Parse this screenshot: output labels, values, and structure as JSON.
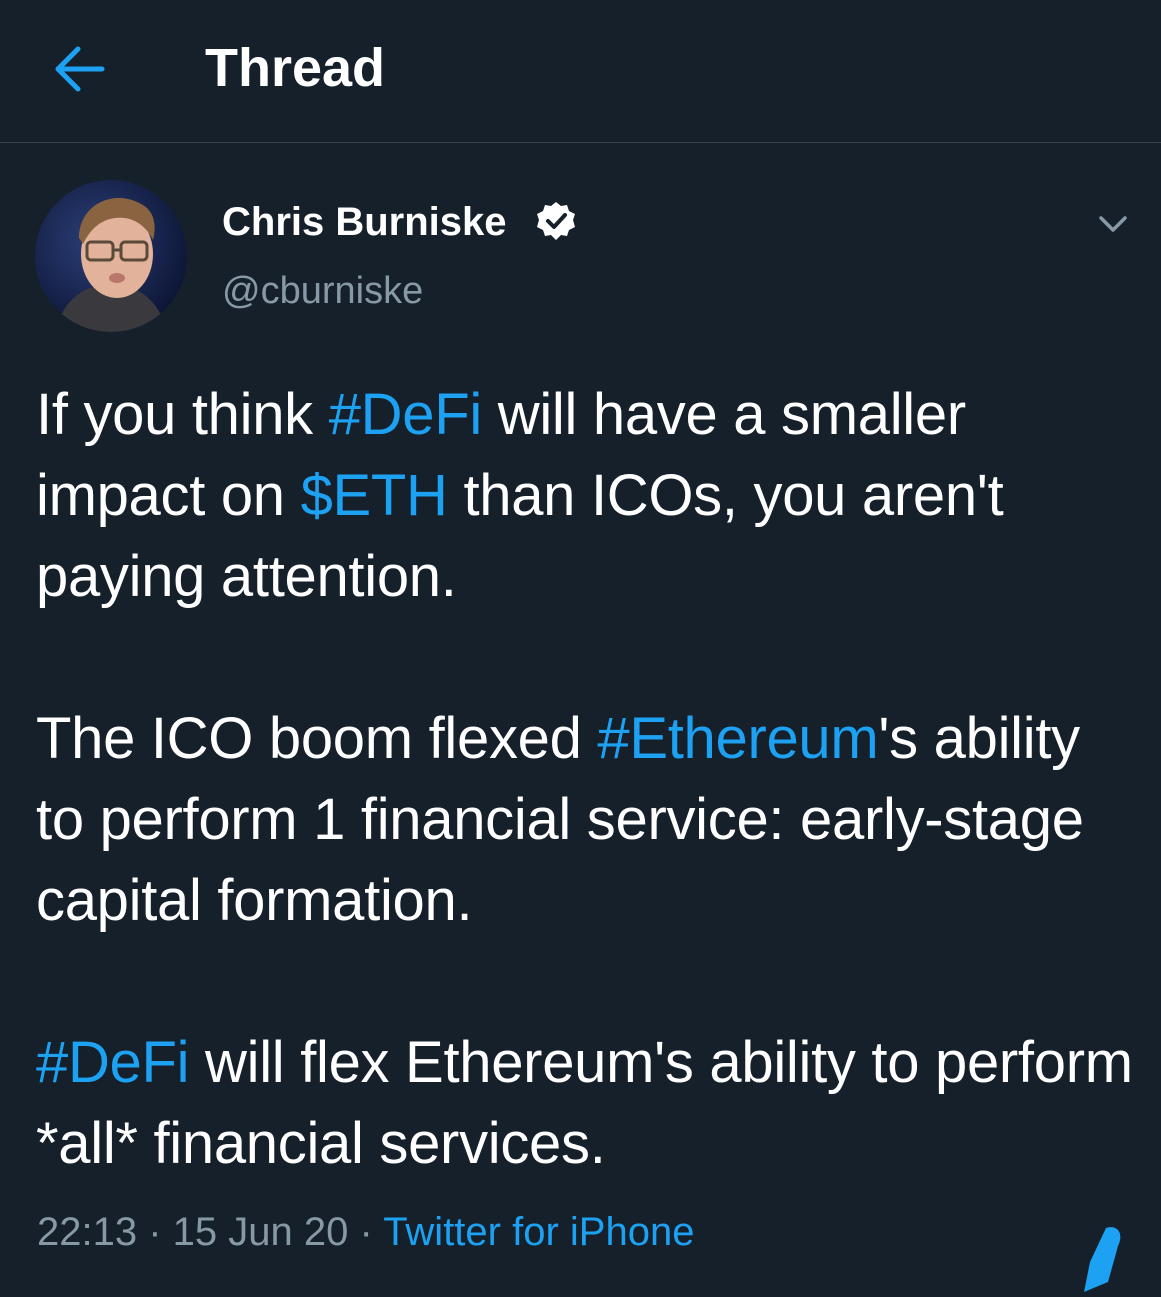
{
  "header": {
    "title": "Thread",
    "back_icon": "arrow-left-icon"
  },
  "tweet": {
    "author": {
      "name": "Chris Burniske",
      "handle": "@cburniske",
      "verified": true
    },
    "paragraphs": [
      {
        "parts": [
          {
            "text": "If you think ",
            "link": false
          },
          {
            "text": "#DeFi",
            "link": true
          },
          {
            "text": " will have a smaller impact on ",
            "link": false
          },
          {
            "text": "$ETH",
            "link": true
          },
          {
            "text": " than ICOs, you aren't paying attention.",
            "link": false
          }
        ]
      },
      {
        "parts": [
          {
            "text": "The ICO boom flexed ",
            "link": false
          },
          {
            "text": "#Ethereum",
            "link": true
          },
          {
            "text": "'s ability to perform 1 financial service: early-stage capital formation.",
            "link": false
          }
        ]
      },
      {
        "parts": [
          {
            "text": "#DeFi",
            "link": true
          },
          {
            "text": " will flex Ethereum's ability to perform *all* financial services.",
            "link": false
          }
        ]
      }
    ],
    "time": "22:13",
    "separator": " · ",
    "date": "15 Jun 20",
    "source": "Twitter for iPhone"
  },
  "colors": {
    "background": "#15202b",
    "accent": "#1da1f2",
    "secondary_text": "#8899a6",
    "divider": "#38444d"
  }
}
